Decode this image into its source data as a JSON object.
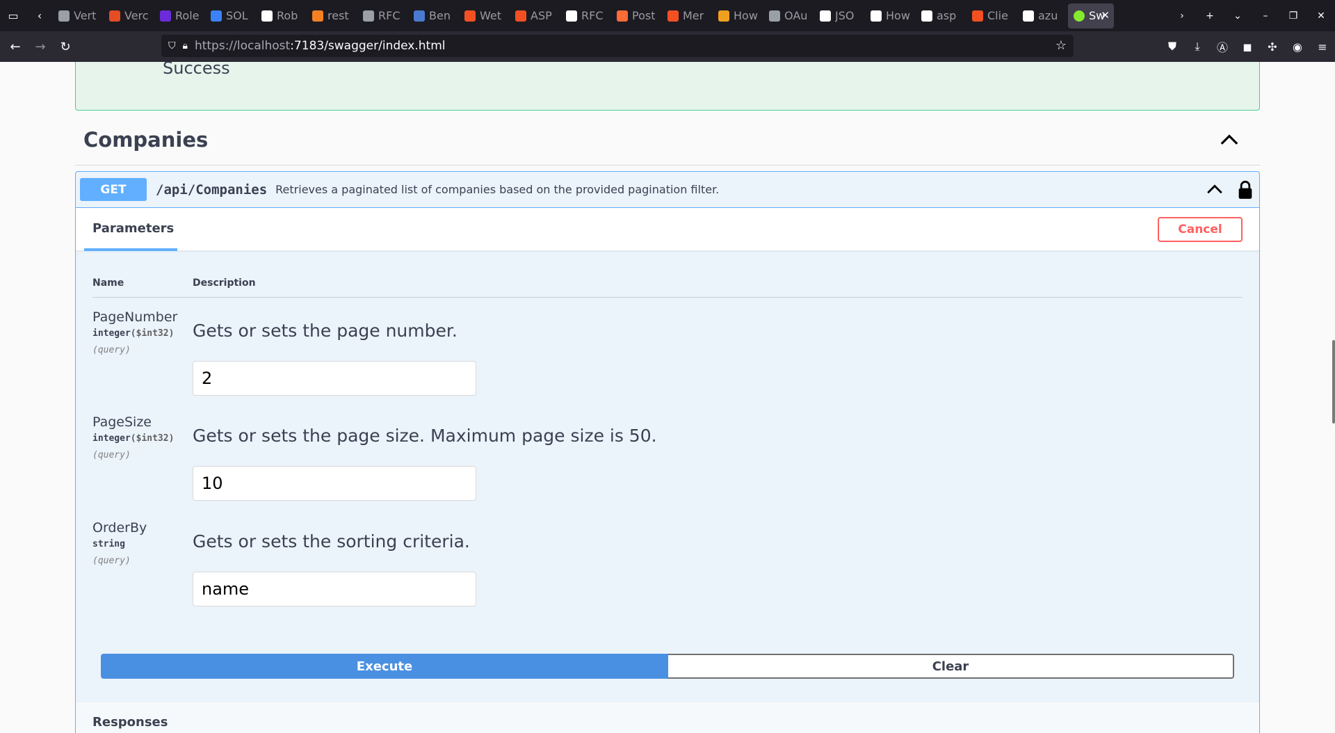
{
  "browser": {
    "tabs": [
      {
        "title": "Vert",
        "icon": "rocket-icon",
        "color": "#9aa0a6"
      },
      {
        "title": "Verc",
        "icon": "vercel-icon",
        "color": "#e44d26"
      },
      {
        "title": "Role",
        "icon": "f-icon",
        "color": "#6c2bd9"
      },
      {
        "title": "SOL",
        "icon": "doc-icon",
        "color": "#3b82f6"
      },
      {
        "title": "Rob",
        "icon": "wiki-icon",
        "color": "#ffffff"
      },
      {
        "title": "rest",
        "icon": "stackoverflow-icon",
        "color": "#f48024"
      },
      {
        "title": "RFC",
        "icon": "rfc-icon",
        "color": "#9aa0a6"
      },
      {
        "title": "Ben",
        "icon": "a-icon",
        "color": "#4a7bd0"
      },
      {
        "title": "Wet",
        "icon": "microsoft-icon",
        "color": "#f25022"
      },
      {
        "title": "ASP",
        "icon": "microsoft-icon",
        "color": "#f25022"
      },
      {
        "title": "RFC",
        "icon": "ietf-icon",
        "color": "#ffffff"
      },
      {
        "title": "Post",
        "icon": "postman-icon",
        "color": "#ff6c37"
      },
      {
        "title": "Mer",
        "icon": "microsoft-icon",
        "color": "#f25022"
      },
      {
        "title": "How",
        "icon": "howto-icon",
        "color": "#f0a020"
      },
      {
        "title": "OAu",
        "icon": "oauth-icon",
        "color": "#9aa0a6"
      },
      {
        "title": "JSO",
        "icon": "shield-icon",
        "color": "#ffffff"
      },
      {
        "title": "How",
        "icon": "shield-icon",
        "color": "#ffffff"
      },
      {
        "title": "asp",
        "icon": "github-icon",
        "color": "#ffffff"
      },
      {
        "title": "Clie",
        "icon": "microsoft-icon",
        "color": "#f25022"
      },
      {
        "title": "azu",
        "icon": "github-icon",
        "color": "#ffffff"
      }
    ],
    "active_tab": {
      "title": "Sw",
      "icon": "swagger-icon",
      "color": "#85ea2d"
    },
    "url_host": "https://localhost",
    "url_rest": ":7183/swagger/index.html"
  },
  "page": {
    "success_text": "Success",
    "section_title": "Companies",
    "operation": {
      "method": "GET",
      "path": "/api/Companies",
      "summary": "Retrieves a paginated list of companies based on the provided pagination filter."
    },
    "parameters_tab": "Parameters",
    "cancel_label": "Cancel",
    "columns": {
      "name": "Name",
      "description": "Description"
    },
    "params": [
      {
        "name": "PageNumber",
        "type": "integer",
        "format": "($int32)",
        "in": "(query)",
        "description": "Gets or sets the page number.",
        "value": "2"
      },
      {
        "name": "PageSize",
        "type": "integer",
        "format": "($int32)",
        "in": "(query)",
        "description": "Gets or sets the page size. Maximum page size is 50.",
        "value": "10"
      },
      {
        "name": "OrderBy",
        "type": "string",
        "format": "",
        "in": "(query)",
        "description": "Gets or sets the sorting criteria.",
        "value": "name"
      }
    ],
    "execute_label": "Execute",
    "clear_label": "Clear",
    "responses_label": "Responses"
  },
  "colors": {
    "get_method": "#61affe",
    "success_border": "#49cc90",
    "cancel": "#ff6060",
    "execute": "#4990e2"
  }
}
